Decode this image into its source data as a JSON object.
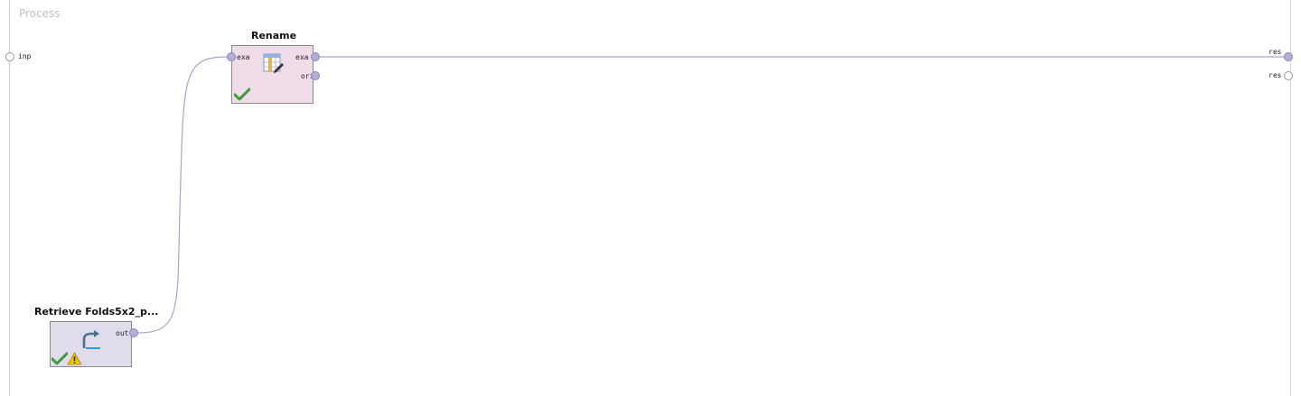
{
  "process": {
    "title": "Process"
  },
  "process_ports": {
    "input": "inp",
    "results": [
      "res",
      "res"
    ]
  },
  "operators": {
    "rename": {
      "title": "Rename",
      "ports_in": [
        "exa"
      ],
      "ports_out": [
        "exa",
        "ori"
      ],
      "status": "ok",
      "icon": "table-edit-icon"
    },
    "retrieve": {
      "title": "Retrieve Folds5x2_p...",
      "ports_out": [
        "out"
      ],
      "status": "warning",
      "icon": "retrieve-arrow-icon"
    }
  },
  "colors": {
    "wire": "#a8a4d4",
    "rename_bg": "#f0dbe8",
    "retrieve_bg": "#e0dcec",
    "port_fill": "#b3aed9",
    "check": "#3c9a3c",
    "warning": "#f2c300"
  }
}
